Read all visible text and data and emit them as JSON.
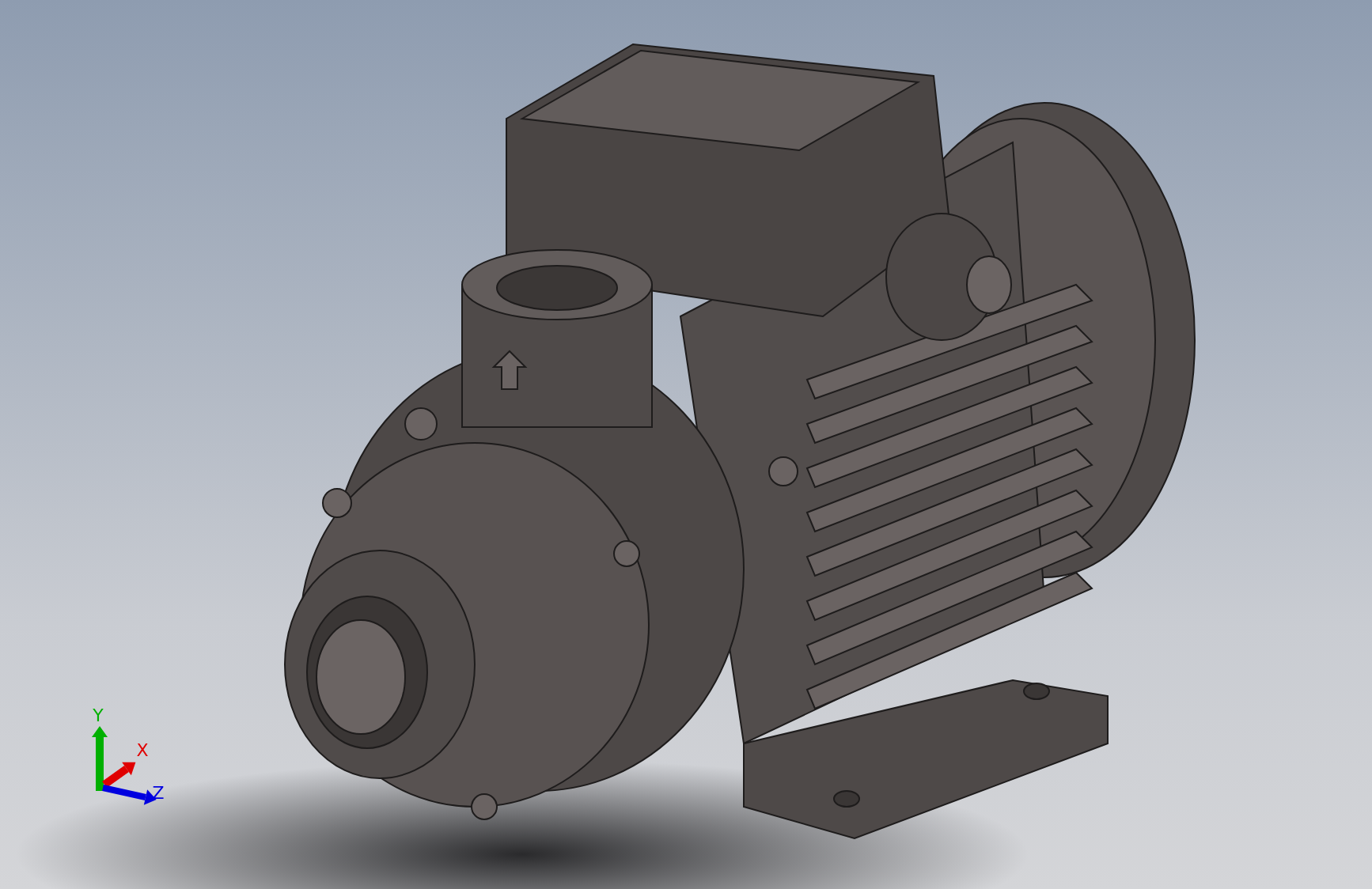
{
  "viewport": {
    "model": {
      "kind": "pump"
    },
    "triad": {
      "axes": [
        {
          "kind": "up",
          "label": "Y",
          "color": "#00b000"
        },
        {
          "kind": "depth",
          "label": "X",
          "color": "#e00000"
        },
        {
          "kind": "right",
          "label": "Z",
          "color": "#0000e0"
        }
      ]
    }
  }
}
